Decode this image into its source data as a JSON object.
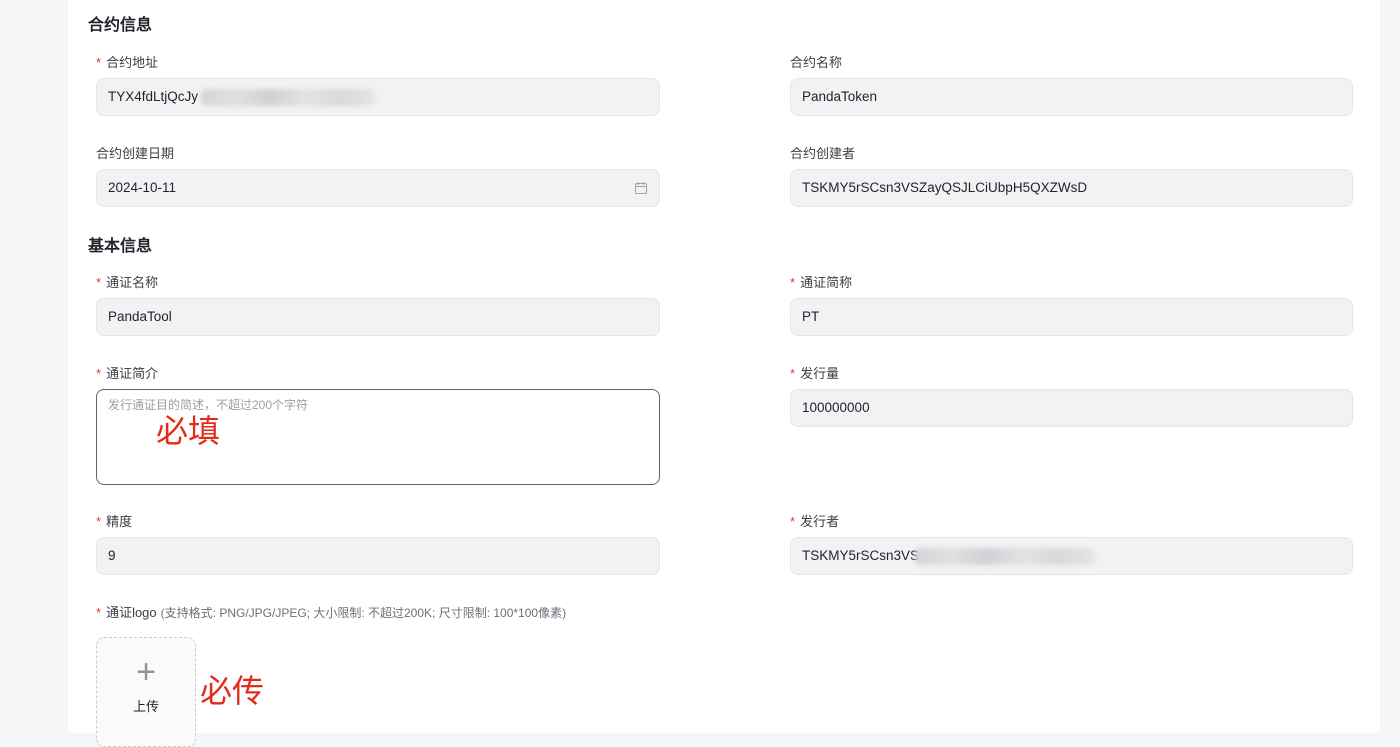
{
  "sections": {
    "contract_title": "合约信息",
    "basic_title": "基本信息"
  },
  "contract": {
    "address": {
      "label": "合约地址",
      "required": "*",
      "value": "TYX4fdLtjQcJy"
    },
    "name": {
      "label": "合约名称",
      "value": "PandaToken"
    },
    "created_date": {
      "label": "合约创建日期",
      "value": "2024-10-11",
      "icon": "calendar-icon"
    },
    "creator": {
      "label": "合约创建者",
      "value": "TSKMY5rSCsn3VSZayQSJLCiUbpH5QXZWsD"
    }
  },
  "basic": {
    "token_name": {
      "label": "通证名称",
      "required": "*",
      "value": "PandaTool"
    },
    "token_symbol": {
      "label": "通证简称",
      "required": "*",
      "value": "PT"
    },
    "token_intro": {
      "label": "通证简介",
      "required": "*",
      "placeholder": "发行通证目的简述，不超过200个字符"
    },
    "supply": {
      "label": "发行量",
      "required": "*",
      "value": "100000000"
    },
    "precision": {
      "label": "精度",
      "required": "*",
      "value": "9"
    },
    "issuer": {
      "label": "发行者",
      "required": "*",
      "value": "TSKMY5rSCsn3VS"
    },
    "logo": {
      "label": "通证logo",
      "required": "*",
      "hint": "(支持格式: PNG/JPG/JPEG; 大小限制: 不超过200K; 尺寸限制: 100*100像素)",
      "upload_label": "上传",
      "upload_icon": "plus-icon"
    }
  },
  "annotations": {
    "required_fill": "必填",
    "required_upload": "必传"
  },
  "colors": {
    "annotation": "#e52a1a",
    "required_star": "#e53935"
  }
}
